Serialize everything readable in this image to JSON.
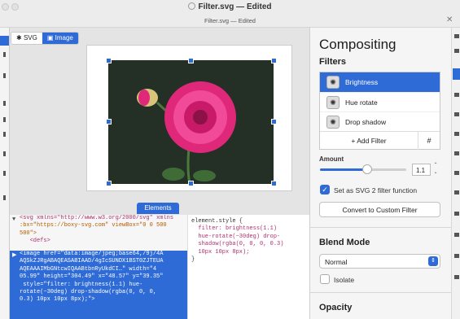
{
  "window": {
    "title": "Filter.svg — Edited",
    "tab_title": "Filter.svg — Edited"
  },
  "view_toggle": {
    "svg_label": "SVG",
    "image_label": "Image",
    "active": "Image"
  },
  "panel_tab": {
    "label": "Elements"
  },
  "code_lines": [
    {
      "text": "<svg xmlns=\"http://www.w3.org/2000/svg\" xmlns",
      "cls": "tag"
    },
    {
      "text": ":bx=\"https://boxy-svg.com\" viewBox=\"0 0 500",
      "cls": "attr"
    },
    {
      "text": "500\">",
      "cls": "attr"
    },
    {
      "text": "   <defs>",
      "cls": "tag"
    }
  ],
  "code_selected_lines": [
    "<image href=\"data:image/jpeg;base64,/9j/4A",
    "AQSkZJRgABAQEASABIAAD/4gIcSUNDX1BST0ZJTEUA",
    "AQEAAAIMbGNtcwIQAABtbnRyUkdCI…\" width=\"4",
    "05.99\" height=\"304.49\" x=\"48.57\" y=\"39.35\"",
    " style=\"filter: brightness(1.1) hue-",
    "rotate(−30deg) drop-shadow(rgba(0, 0, 0,",
    "0.3) 10px 10px 8px);\">"
  ],
  "css_panel": {
    "selector": "element.style {",
    "lines": [
      "  filter: brightness(1.1)",
      "  hue-rotate(−30deg) drop-",
      "  shadow(rgba(0, 0, 0, 0.3)",
      "  10px 10px 8px);"
    ],
    "close": "}"
  },
  "sidebar": {
    "title": "Compositing",
    "filters_heading": "Filters",
    "filters": [
      {
        "label": "Brightness",
        "selected": true
      },
      {
        "label": "Hue rotate",
        "selected": false
      },
      {
        "label": "Drop shadow",
        "selected": false
      }
    ],
    "add_filter_label": "+ Add Filter",
    "hash_label": "#",
    "amount_label": "Amount",
    "amount_value": "1.1",
    "amount_fraction": 0.55,
    "svg2_checkbox_label": "Set as SVG 2 filter function",
    "svg2_checked": true,
    "convert_button_label": "Convert to Custom Filter",
    "blend_heading": "Blend Mode",
    "blend_value": "Normal",
    "isolate_label": "Isolate",
    "isolate_checked": false,
    "opacity_heading": "Opacity"
  },
  "colors": {
    "accent": "#2e6bd6",
    "flower": "#e0287a",
    "photo_bg": "#243025"
  },
  "icons": {
    "close_window": "close-icon",
    "svg_mode": "asterisk-icon",
    "image_mode": "monitor-icon",
    "filter_item": "color-wheel-icon",
    "dropdown": "chevron-updown-icon"
  }
}
